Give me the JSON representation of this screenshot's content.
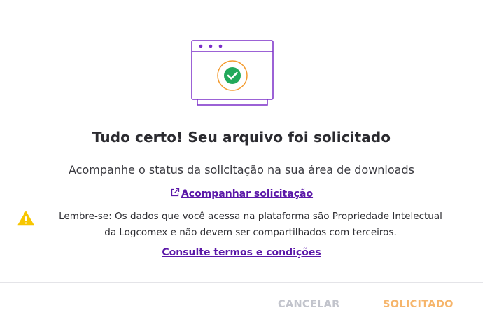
{
  "dialog": {
    "illustration_icon": "browser-window-check-icon",
    "title": "Tudo certo! Seu arquivo foi solicitado",
    "subtitle": "Acompanhe o status da solicitação na sua área de downloads",
    "track_link": {
      "icon": "external-link-icon",
      "label": "Acompanhar solicitação"
    },
    "notice": {
      "icon": "warning-icon",
      "text": "Lembre-se: Os dados que você acessa na plataforma são Propriedade Intelectual da Logcomex e não devem ser compartilhados com terceiros."
    },
    "terms_link": "Consulte termos e condições",
    "buttons": {
      "cancel": "CANCELAR",
      "requested": "SOLICITADO"
    }
  },
  "colors": {
    "brand_purple": "#5b18a8",
    "illustration_purple": "#7b2fc9",
    "success_green": "#22a95b",
    "accent_orange": "#f39a2e",
    "warning_yellow": "#f7c600",
    "disabled_gray": "#c2c4cc",
    "requested_orange": "#f6b56b"
  }
}
